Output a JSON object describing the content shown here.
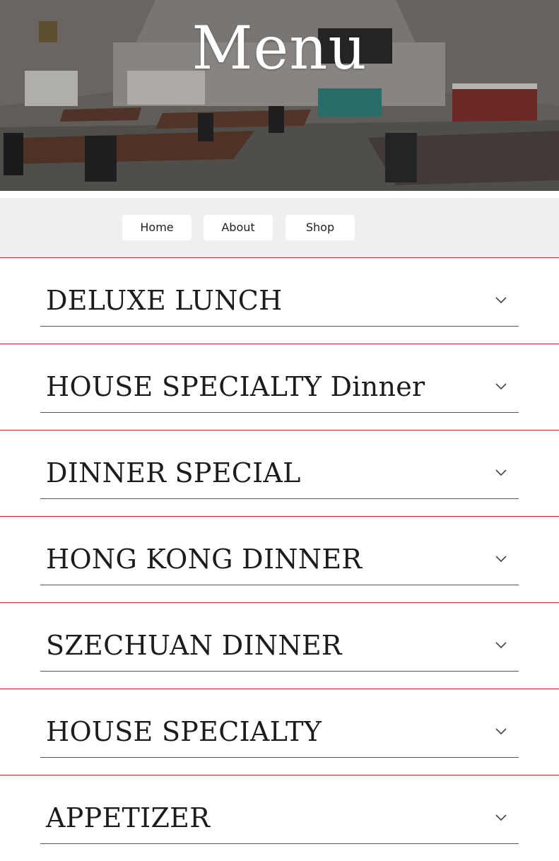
{
  "hero": {
    "title": "Menu"
  },
  "nav": {
    "items": [
      {
        "label": "Home"
      },
      {
        "label": "About"
      },
      {
        "label": "Shop"
      }
    ]
  },
  "sections": [
    {
      "title": "DELUXE LUNCH",
      "icon": "chevron-down-icon"
    },
    {
      "title": "HOUSE SPECIALTY Dinner",
      "icon": "chevron-down-icon"
    },
    {
      "title": "DINNER SPECIAL",
      "icon": "chevron-down-icon"
    },
    {
      "title": "HONG KONG DINNER",
      "icon": "chevron-down-icon"
    },
    {
      "title": "SZECHUAN DINNER",
      "icon": "chevron-down-icon"
    },
    {
      "title": "HOUSE SPECIALTY",
      "icon": "chevron-down-icon"
    },
    {
      "title": "APPETIZER",
      "icon": "chevron-down-icon"
    }
  ],
  "colors": {
    "divider": "#d92b2b",
    "nav_background": "#efefef",
    "text": "#1c1c1c"
  }
}
